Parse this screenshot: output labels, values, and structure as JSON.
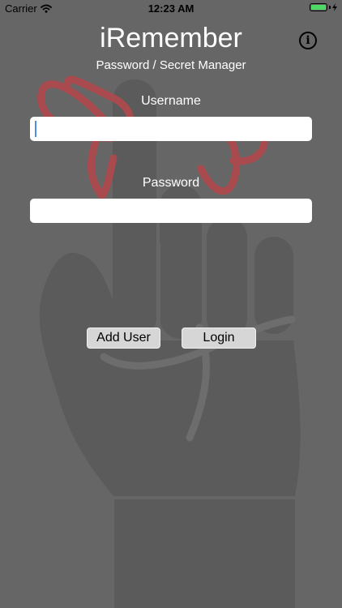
{
  "status_bar": {
    "carrier": "Carrier",
    "time": "12:23 AM",
    "battery_level": 1.0,
    "battery_color": "#4cd964",
    "wifi_icon": "wifi-icon",
    "charging_icon": "bolt-icon"
  },
  "header": {
    "title": "iRemember",
    "subtitle": "Password / Secret Manager",
    "info_icon": "info-icon"
  },
  "form": {
    "username_label": "Username",
    "username_value": "",
    "password_label": "Password",
    "password_value": ""
  },
  "actions": {
    "add_user_label": "Add User",
    "login_label": "Login"
  },
  "theme": {
    "background": "#666666",
    "hand_color": "#5b5b5b",
    "ribbon_color": "#a94a4e"
  }
}
